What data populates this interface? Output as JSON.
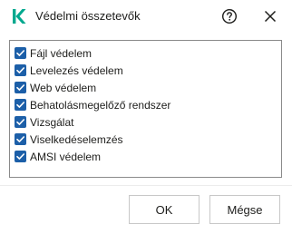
{
  "window": {
    "title": "Védelmi összetevők",
    "logo_icon": "kaspersky-k-logo",
    "accent_color": "#00a88e"
  },
  "titlebar_buttons": {
    "help_icon": "question-circle-icon",
    "close_icon": "close-icon"
  },
  "components": [
    {
      "label": "Fájl védelem",
      "checked": true
    },
    {
      "label": "Levelezés védelem",
      "checked": true
    },
    {
      "label": "Web védelem",
      "checked": true
    },
    {
      "label": "Behatolásmegelőző rendszer",
      "checked": true
    },
    {
      "label": "Vizsgálat",
      "checked": true
    },
    {
      "label": "Viselkedéselemzés",
      "checked": true
    },
    {
      "label": "AMSI védelem",
      "checked": true
    }
  ],
  "checkbox_color": "#1c5fa8",
  "buttons": {
    "ok_label": "OK",
    "cancel_label": "Mégse"
  }
}
